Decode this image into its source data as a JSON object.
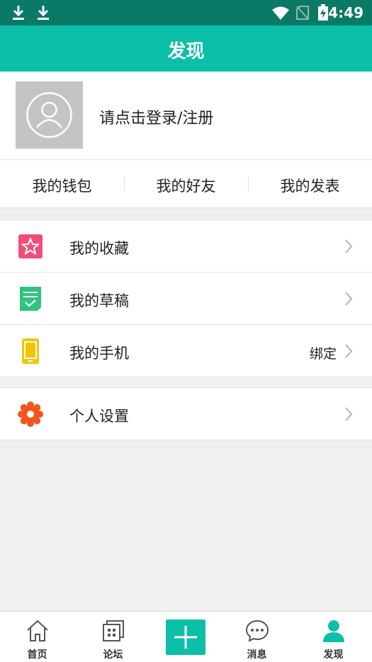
{
  "status_bar": {
    "time": "4:49"
  },
  "header": {
    "title": "发现"
  },
  "profile": {
    "login_prompt": "请点击登录/注册"
  },
  "quick_links": [
    {
      "label": "我的钱包"
    },
    {
      "label": "我的好友"
    },
    {
      "label": "我的发表"
    }
  ],
  "menu": {
    "favorites": {
      "label": "我的收藏",
      "icon": "star-icon"
    },
    "drafts": {
      "label": "我的草稿",
      "icon": "draft-icon"
    },
    "phone": {
      "label": "我的手机",
      "icon": "phone-icon",
      "extra": "绑定"
    },
    "settings": {
      "label": "个人设置",
      "icon": "gear-icon"
    }
  },
  "bottom_nav": [
    {
      "label": "首页",
      "icon": "home-icon"
    },
    {
      "label": "论坛",
      "icon": "forum-icon"
    },
    {
      "label": "",
      "icon": "plus-icon"
    },
    {
      "label": "消息",
      "icon": "message-icon"
    },
    {
      "label": "发现",
      "icon": "discover-icon"
    }
  ],
  "colors": {
    "accent": "#0bbfa8",
    "status_bar": "#0a7a66",
    "star": "#f04e78",
    "draft": "#2ec47e",
    "phone": "#f5c400",
    "gear": "#f2551e"
  }
}
